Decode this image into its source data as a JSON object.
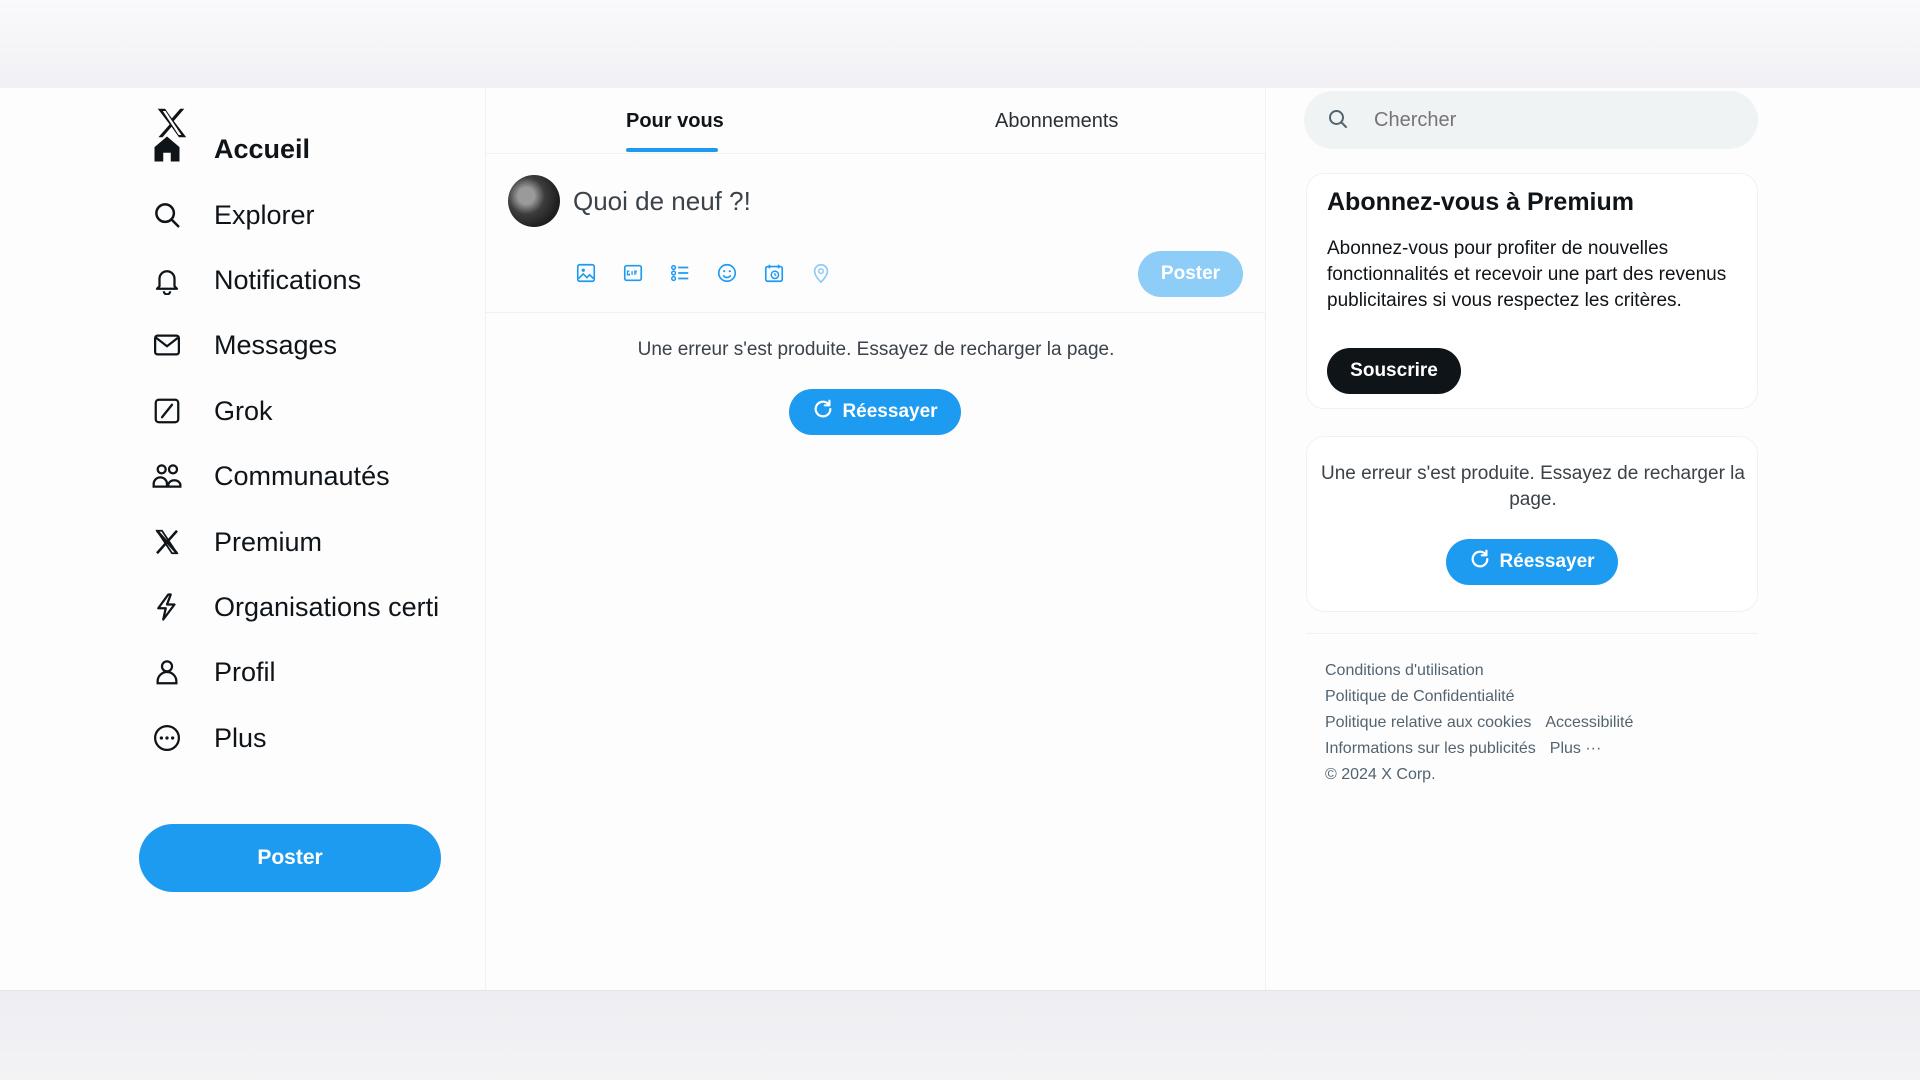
{
  "sidebar": {
    "logo": "x-logo",
    "items": [
      {
        "label": "Accueil",
        "icon": "home-icon"
      },
      {
        "label": "Explorer",
        "icon": "search-icon"
      },
      {
        "label": "Notifications",
        "icon": "bell-icon"
      },
      {
        "label": "Messages",
        "icon": "envelope-icon"
      },
      {
        "label": "Grok",
        "icon": "grok-icon"
      },
      {
        "label": "Communautés",
        "icon": "people-icon"
      },
      {
        "label": "Premium",
        "icon": "x-icon"
      },
      {
        "label": "Organisations certi",
        "icon": "lightning-icon"
      },
      {
        "label": "Profil",
        "icon": "person-icon"
      },
      {
        "label": "Plus",
        "icon": "more-circle-icon"
      }
    ],
    "post_label": "Poster"
  },
  "main": {
    "tabs": [
      {
        "label": "Pour vous",
        "active": true
      },
      {
        "label": "Abonnements",
        "active": false
      }
    ],
    "compose": {
      "placeholder": "Quoi de neuf ?!",
      "post_label": "Poster",
      "tools": [
        "image-icon",
        "gif-icon",
        "poll-icon",
        "emoji-icon",
        "schedule-icon",
        "location-icon"
      ]
    },
    "error": {
      "message": "Une erreur s'est produite. Essayez de recharger la page.",
      "retry_label": "Réessayer"
    }
  },
  "right": {
    "search": {
      "placeholder": "Chercher"
    },
    "premium": {
      "title": "Abonnez-vous à Premium",
      "description": "Abonnez-vous pour profiter de nouvelles fonctionnalités et recevoir une part des revenus publicitaires si vous respectez les critères.",
      "subscribe_label": "Souscrire"
    },
    "error": {
      "message": "Une erreur s'est produite. Essayez de recharger la page.",
      "retry_label": "Réessayer"
    },
    "footer": {
      "terms": "Conditions d'utilisation",
      "privacy": "Politique de Confidentialité",
      "cookies": "Politique relative aux cookies",
      "accessibility": "Accessibilité",
      "ads": "Informations sur les publicités",
      "more": "Plus ···",
      "copyright": "© 2024 X Corp."
    }
  },
  "colors": {
    "accent": "#1d9bf0",
    "accent_disabled": "#8ecdf8",
    "text": "#0f1419",
    "muted": "#536471"
  }
}
